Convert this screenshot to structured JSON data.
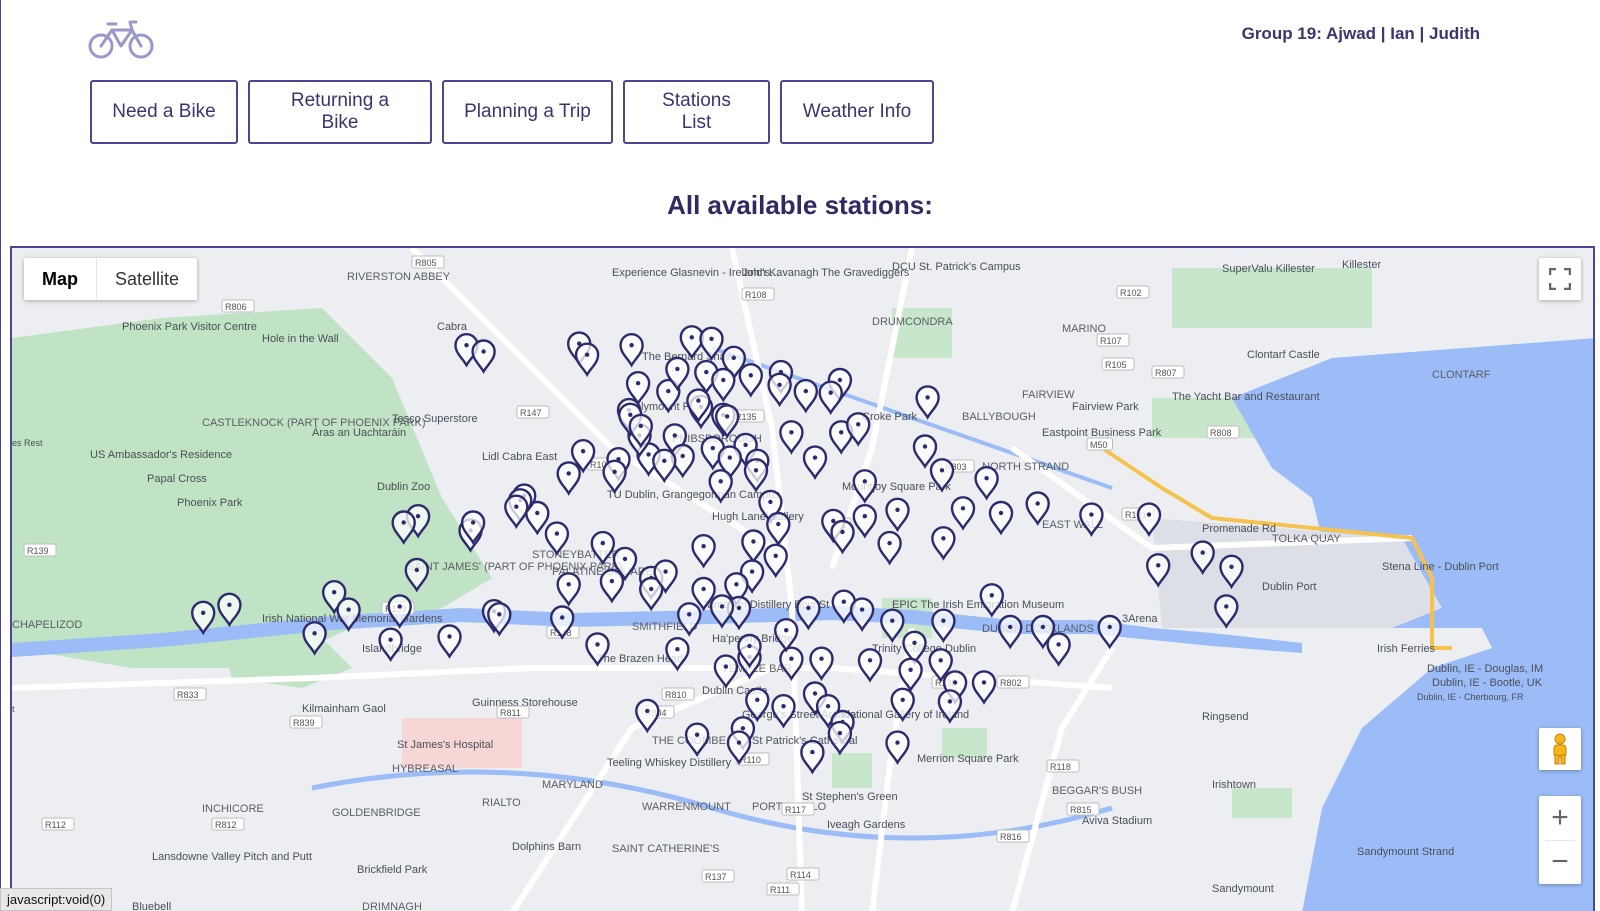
{
  "header": {
    "logo_icon": "bicycle-icon",
    "group_names": "Group 19: Ajwad | Ian | Judith"
  },
  "nav": {
    "buttons": [
      "Need a Bike",
      "Returning a Bike",
      "Planning a Trip",
      "Stations List",
      "Weather Info"
    ]
  },
  "main": {
    "heading": "All available stations:"
  },
  "map": {
    "type_control": {
      "map": "Map",
      "satellite": "Satellite",
      "selected": "Map"
    },
    "controls": {
      "fullscreen_icon": "fullscreen-icon",
      "pegman_icon": "pegman-icon",
      "zoom_in": "+",
      "zoom_out": "−"
    },
    "place_labels": [
      "Killester",
      "SuperValu Killester",
      "RIVERSTON ABBEY",
      "Experience Glasnevin - Ireland's...",
      "John Kavanagh The Gravediggers",
      "DCU St. Patrick's Campus",
      "Cabra",
      "Phoenix Park Visitor Centre",
      "Hole in the Wall",
      "DRUMCONDRA",
      "MARINO",
      "The Bernard Shaw",
      "Clontarf Castle",
      "CLONTARF",
      "FAIRVIEW",
      "Fairview Park",
      "The Yacht Bar and Restaurant",
      "Dalymount Park",
      "Croke Park",
      "BALLYBOUGH",
      "Eastpoint Business Park",
      "CASTLEKNOCK (PART OF PHOENIX PARK)",
      "Tesco Superstore",
      "Áras an Uachtaráin",
      "US Ambassador's Residence",
      "Lidl Cabra East",
      "PHIBSBOROUGH",
      "NORTH STRAND",
      "Papal Cross",
      "Dublin Zoo",
      "TU Dublin, Grangegorman Campus",
      "Mountjoy Square Park",
      "Phoenix Park",
      "Hugh Lane Gallery",
      "EAST WALL",
      "Promenade Rd",
      "TOLKA QUAY",
      "STONEYBATTER",
      "PALATINE SQUARE",
      "Stena Line - Dublin Port",
      "SAINT JAMES' (PART OF PHOENIX PARK)",
      "Jameson Distillery Bow St",
      "EPIC The Irish Emigration Museum",
      "Dublin Port",
      "3Arena",
      "CHAPELIZOD",
      "Irish National War Memorial Gardens",
      "SMITHFIELD",
      "DUBLIN DOCKLANDS",
      "Islandbridge",
      "Ha'penny Bridge",
      "Trinity College Dublin",
      "Irish Ferries",
      "The Brazen Head",
      "TEMPLE BAR",
      "Dublin Castle",
      "Kilmainham Gaol",
      "Guinness Storehouse",
      "Ringsend",
      "George's Street Arcade",
      "National Gallery of Ireland",
      "St James's Hospital",
      "HYBREASAL",
      "THE COOMBE",
      "St Patrick's Cathedral",
      "Merrion Square Park",
      "Teeling Whiskey Distillery",
      "RIALTO",
      "MARYLAND",
      "Irishtown",
      "INCHICORE",
      "GOLDENBRIDGE",
      "WARRENMOUNT",
      "PORTOBELLO",
      "St Stephen's Green",
      "BEGGAR'S BUSH",
      "Iveagh Gardens",
      "Aviva Stadium",
      "Dolphins Barn",
      "SAINT CATHERINE'S",
      "Lansdowne Valley Pitch and Putt",
      "Brickfield Park",
      "Sandymount Strand",
      "Sandymount",
      "Bluebell",
      "DRIMNAGH",
      "Dublin, IE - Douglas, IM",
      "Dublin, IE - Bootle, UK",
      "Dublin, IE - Cherbourg, FR",
      "es Rest",
      "t"
    ],
    "road_labels": [
      "R805",
      "R102",
      "R108",
      "R806",
      "R147",
      "R135",
      "R107",
      "R105",
      "R807",
      "R101",
      "R803",
      "R808",
      "M50",
      "R131",
      "R139",
      "R109",
      "R148",
      "R138",
      "R802",
      "R810",
      "R811",
      "R833",
      "R839",
      "R112",
      "R812",
      "R137",
      "R110",
      "R111",
      "R114",
      "R117",
      "R118",
      "R815",
      "R816",
      "R804",
      "N1"
    ],
    "marker_icon": "bike-station-marker-icon",
    "marker_color": "#2d2a6e",
    "markers": [
      {
        "x": -6.2818,
        "y": 53.3591
      },
      {
        "x": -6.2805,
        "y": 53.3587
      },
      {
        "x": -6.2732,
        "y": 53.3592
      },
      {
        "x": -6.2692,
        "y": 53.3591
      },
      {
        "x": -6.2646,
        "y": 53.3596
      },
      {
        "x": -6.2631,
        "y": 53.3595
      },
      {
        "x": -6.2614,
        "y": 53.3583
      },
      {
        "x": -6.2635,
        "y": 53.3574
      },
      {
        "x": -6.2687,
        "y": 53.3567
      },
      {
        "x": -6.2664,
        "y": 53.3562
      },
      {
        "x": -6.2657,
        "y": 53.3576
      },
      {
        "x": -6.2622,
        "y": 53.3569
      },
      {
        "x": -6.2601,
        "y": 53.3572
      },
      {
        "x": -6.2578,
        "y": 53.3574
      },
      {
        "x": -6.2639,
        "y": 53.3552
      },
      {
        "x": -6.257,
        "y": 53.3536
      },
      {
        "x": -6.2641,
        "y": 53.3556
      },
      {
        "x": -6.2622,
        "y": 53.3547
      },
      {
        "x": -6.2619,
        "y": 53.3546
      },
      {
        "x": -6.2659,
        "y": 53.3534
      },
      {
        "x": -6.2532,
        "y": 53.3536
      },
      {
        "x": -6.2533,
        "y": 53.3569
      },
      {
        "x": -6.2468,
        "y": 53.3527
      },
      {
        "x": -6.2466,
        "y": 53.3558
      },
      {
        "x": -6.2519,
        "y": 53.3541
      },
      {
        "x": -6.2605,
        "y": 53.3528
      },
      {
        "x": -6.263,
        "y": 53.3526
      },
      {
        "x": -6.2596,
        "y": 53.3518
      },
      {
        "x": -6.2653,
        "y": 53.3521
      },
      {
        "x": -6.2679,
        "y": 53.3522
      },
      {
        "x": -6.2702,
        "y": 53.3519
      },
      {
        "x": -6.2729,
        "y": 53.3524
      },
      {
        "x": -6.2667,
        "y": 53.3518
      },
      {
        "x": -6.2686,
        "y": 53.3534
      },
      {
        "x": -6.274,
        "y": 53.351
      },
      {
        "x": -6.2705,
        "y": 53.3511
      },
      {
        "x": -6.2617,
        "y": 53.352
      },
      {
        "x": -6.2597,
        "y": 53.3512
      },
      {
        "x": -6.2586,
        "y": 53.3492
      },
      {
        "x": -6.258,
        "y": 53.3478
      },
      {
        "x": -6.2538,
        "y": 53.348
      },
      {
        "x": -6.2514,
        "y": 53.3483
      },
      {
        "x": -6.2489,
        "y": 53.3487
      },
      {
        "x": -6.2439,
        "y": 53.3488
      },
      {
        "x": -6.2454,
        "y": 53.3469
      },
      {
        "x": -6.241,
        "y": 53.3485
      },
      {
        "x": -6.2382,
        "y": 53.3491
      },
      {
        "x": -6.2341,
        "y": 53.3484
      },
      {
        "x": -6.2297,
        "y": 53.3484
      },
      {
        "x": -6.2495,
        "y": 53.3466
      },
      {
        "x": -6.2531,
        "y": 53.3473
      },
      {
        "x": -6.2599,
        "y": 53.3467
      },
      {
        "x": -6.2637,
        "y": 53.3464
      },
      {
        "x": -6.2582,
        "y": 53.3458
      },
      {
        "x": -6.26,
        "y": 53.3448
      },
      {
        "x": -6.2612,
        "y": 53.344
      },
      {
        "x": -6.2637,
        "y": 53.3437
      },
      {
        "x": -6.2677,
        "y": 53.3444
      },
      {
        "x": -6.2697,
        "y": 53.3456
      },
      {
        "x": -6.2714,
        "y": 53.3466
      },
      {
        "x": -6.2749,
        "y": 53.3472
      },
      {
        "x": -6.2764,
        "y": 53.3485
      },
      {
        "x": -6.2815,
        "y": 53.3474
      },
      {
        "x": -6.2813,
        "y": 53.3479
      },
      {
        "x": -6.2855,
        "y": 53.3483
      },
      {
        "x": -6.2866,
        "y": 53.3479
      },
      {
        "x": -6.2856,
        "y": 53.3449
      },
      {
        "x": -6.2869,
        "y": 53.3426
      },
      {
        "x": -6.2797,
        "y": 53.3423
      },
      {
        "x": -6.274,
        "y": 53.344
      },
      {
        "x": -6.2707,
        "y": 53.3442
      },
      {
        "x": -6.2677,
        "y": 53.3437
      },
      {
        "x": -6.2666,
        "y": 53.3448
      },
      {
        "x": -6.2745,
        "y": 53.3419
      },
      {
        "x": -6.2793,
        "y": 53.3421
      },
      {
        "x": -6.2919,
        "y": 53.3435
      },
      {
        "x": -6.2908,
        "y": 53.3424
      },
      {
        "x": -6.2876,
        "y": 53.3405
      },
      {
        "x": -6.2831,
        "y": 53.3407
      },
      {
        "x": -6.2999,
        "y": 53.3427
      },
      {
        "x": -6.3019,
        "y": 53.3422
      },
      {
        "x": -6.2934,
        "y": 53.3409
      },
      {
        "x": -6.261,
        "y": 53.3425
      },
      {
        "x": -6.2557,
        "y": 53.3425
      },
      {
        "x": -6.253,
        "y": 53.3429
      },
      {
        "x": -6.2516,
        "y": 53.3424
      },
      {
        "x": -6.2454,
        "y": 53.3417
      },
      {
        "x": -6.2476,
        "y": 53.3403
      },
      {
        "x": -6.2456,
        "y": 53.3392
      },
      {
        "x": -6.2403,
        "y": 53.3413
      },
      {
        "x": -6.2417,
        "y": 53.3433
      },
      {
        "x": -6.2378,
        "y": 53.3413
      },
      {
        "x": -6.2366,
        "y": 53.3402
      },
      {
        "x": -6.2327,
        "y": 53.3413
      },
      {
        "x": -6.229,
        "y": 53.3452
      },
      {
        "x": -6.2256,
        "y": 53.346
      },
      {
        "x": -6.2234,
        "y": 53.3451
      },
      {
        "x": -6.2238,
        "y": 53.3426
      },
      {
        "x": -6.257,
        "y": 53.3393
      },
      {
        "x": -6.2602,
        "y": 53.3394
      },
      {
        "x": -6.2574,
        "y": 53.3411
      },
      {
        "x": -6.2547,
        "y": 53.3393
      },
      {
        "x": -6.251,
        "y": 53.3392
      },
      {
        "x": -6.2479,
        "y": 53.3386
      },
      {
        "x": -6.2445,
        "y": 53.3378
      },
      {
        "x": -6.2423,
        "y": 53.3378
      },
      {
        "x": -6.2449,
        "y": 53.3366
      },
      {
        "x": -6.2485,
        "y": 53.3367
      },
      {
        "x": -6.2552,
        "y": 53.3371
      },
      {
        "x": -6.2576,
        "y": 53.3363
      },
      {
        "x": -6.2542,
        "y": 53.3363
      },
      {
        "x": -6.2531,
        "y": 53.3353
      },
      {
        "x": -6.2596,
        "y": 53.3367
      },
      {
        "x": -6.2607,
        "y": 53.3349
      },
      {
        "x": -6.2533,
        "y": 53.3346
      },
      {
        "x": -6.2642,
        "y": 53.3345
      },
      {
        "x": -6.261,
        "y": 53.334
      },
      {
        "x": -6.2554,
        "y": 53.3334
      },
      {
        "x": -6.2489,
        "y": 53.334
      },
      {
        "x": -6.2624,
        "y": 53.3505
      },
      {
        "x": -6.2657,
        "y": 53.3399
      },
      {
        "x": -6.262,
        "y": 53.3388
      },
      {
        "x": -6.2493,
        "y": 53.3417
      },
      {
        "x": -6.2514,
        "y": 53.3505
      },
      {
        "x": -6.2552,
        "y": 53.352
      },
      {
        "x": -6.2455,
        "y": 53.3512
      },
      {
        "x": -6.254,
        "y": 53.3561
      },
      {
        "x": -6.2579,
        "y": 53.3566
      },
      {
        "x": -6.2559,
        "y": 53.3562
      },
      {
        "x": -6.2726,
        "y": 53.3585
      },
      {
        "x": -6.2694,
        "y": 53.355
      },
      {
        "x": -6.2693,
        "y": 53.3547
      },
      {
        "x": -6.2685,
        "y": 53.354
      },
      {
        "x": -6.2774,
        "y": 53.3496
      },
      {
        "x": -6.2777,
        "y": 53.3493
      },
      {
        "x": -6.278,
        "y": 53.3489
      },
      {
        "x": -6.2718,
        "y": 53.3402
      },
      {
        "x": -6.2623,
        "y": 53.3426
      },
      {
        "x": -6.2648,
        "y": 53.3421
      },
      {
        "x": -6.268,
        "y": 53.336
      },
      {
        "x": -6.2602,
        "y": 53.3401
      },
      {
        "x": -6.2421,
        "y": 53.3507
      }
    ]
  }
}
